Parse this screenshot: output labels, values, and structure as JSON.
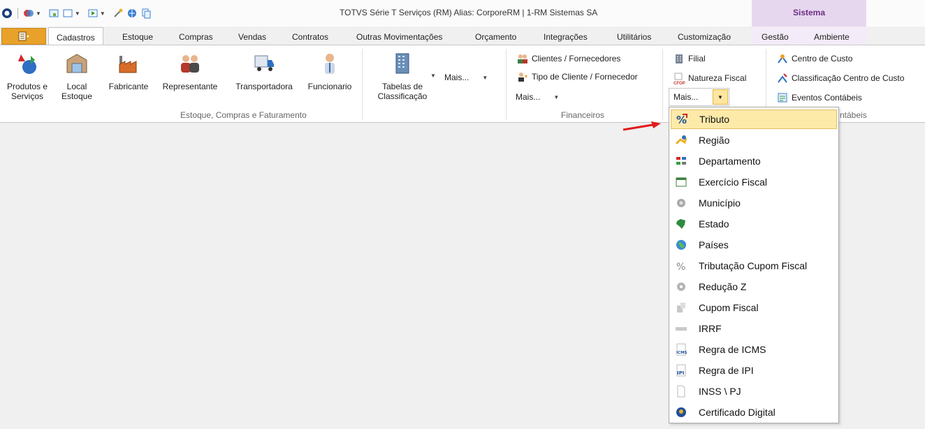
{
  "window": {
    "title": "TOTVS Série T Serviços (RM) Alias: CorporeRM | 1-RM Sistemas SA"
  },
  "context_tab": {
    "label": "Sistema"
  },
  "tabs": [
    {
      "label": "Cadastros",
      "active": true
    },
    {
      "label": "Estoque"
    },
    {
      "label": "Compras"
    },
    {
      "label": "Vendas"
    },
    {
      "label": "Contratos"
    },
    {
      "label": "Outras Movimentações"
    },
    {
      "label": "Orçamento"
    },
    {
      "label": "Integrações"
    },
    {
      "label": "Utilitários"
    },
    {
      "label": "Customização"
    },
    {
      "label": "Gestão"
    },
    {
      "label": "Ambiente"
    }
  ],
  "ribbon": {
    "group1": {
      "label": "Estoque, Compras e Faturamento",
      "produtos": "Produtos e\nServiços",
      "local": "Local\nEstoque",
      "fabricante": "Fabricante",
      "representante": "Representante",
      "transportadora": "Transportadora",
      "funcionario": "Funcionario",
      "tabelas": "Tabelas de\nClassificação",
      "mais": "Mais..."
    },
    "group2": {
      "label": "Financeiros",
      "clientes": "Clientes / Fornecedores",
      "tipo": "Tipo de Cliente / Fornecedor",
      "mais": "Mais..."
    },
    "group3": {
      "filial": "Filial",
      "natureza": "Natureza Fiscal",
      "mais": "Mais..."
    },
    "group4": {
      "label_partial": "ntábeis",
      "centro": "Centro de Custo",
      "classificacao": "Classificação Centro de Custo",
      "eventos": "Eventos Contábeis"
    }
  },
  "dropdown_items": [
    {
      "label": "Tributo",
      "icon": "percent-icon",
      "highlighted": true
    },
    {
      "label": "Região",
      "icon": "region-icon"
    },
    {
      "label": "Departamento",
      "icon": "department-icon"
    },
    {
      "label": "Exercício Fiscal",
      "icon": "calendar-icon"
    },
    {
      "label": "Município",
      "icon": "municipio-icon"
    },
    {
      "label": "Estado",
      "icon": "map-icon"
    },
    {
      "label": "Países",
      "icon": "globe-icon"
    },
    {
      "label": "Tributação Cupom Fiscal",
      "icon": "percent-gray-icon"
    },
    {
      "label": "Redução Z",
      "icon": "gear-gray-icon"
    },
    {
      "label": "Cupom Fiscal",
      "icon": "receipt-icon"
    },
    {
      "label": "IRRF",
      "icon": "irrf-icon"
    },
    {
      "label": "Regra de ICMS",
      "icon": "icms-icon"
    },
    {
      "label": "Regra de IPI",
      "icon": "ipi-icon"
    },
    {
      "label": "INSS \\ PJ",
      "icon": "document-icon"
    },
    {
      "label": "Certificado Digital",
      "icon": "certificate-icon"
    }
  ],
  "badges": {
    "cfop": "CFOP",
    "icms": "ICMS",
    "ipi": "IPI"
  },
  "colors": {
    "accent": "#e8a229",
    "highlight": "#fdeaa8",
    "context": "#e6d7ee",
    "arrow": "#e01b1b"
  }
}
